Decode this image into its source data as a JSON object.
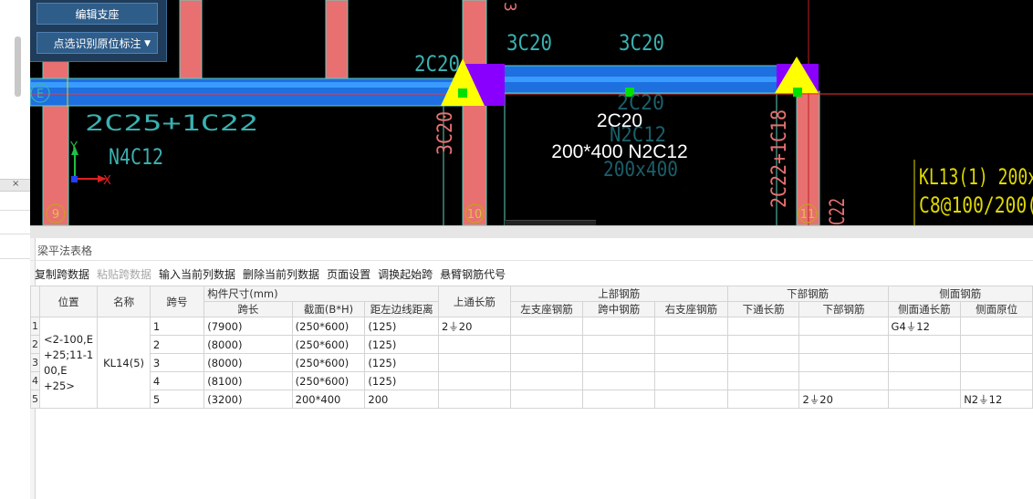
{
  "left_panel": {
    "close_glyph": "×"
  },
  "cad_menu": {
    "edit_support": "编辑支座",
    "pick_label": "点选识别原位标注"
  },
  "canvas": {
    "axes": {
      "grid_9": "9",
      "grid_10": "10",
      "grid_11": "11",
      "grid_E": "E",
      "axis_x": "X",
      "axis_y": "Y"
    },
    "labels": {
      "left_top": "2C25+1C22",
      "left_mid": "N4C12",
      "col_10_side": "3C20",
      "col_10_top": "2C20",
      "span_top_1": "3C20",
      "span_top_2": "3C20",
      "mid_faint_1": "2C20",
      "mid_faint_2": "N2C12",
      "mid_faint_3": "200x400",
      "popup_1": "2C20",
      "popup_2": "200*400 N2C12",
      "col_11_side": "2C22+1C18",
      "col_11_bottom": "C22",
      "top_right_digit": "3",
      "kl13_line1": "KL13(1) 200x",
      "kl13_line2": "C8@100/200("
    },
    "colors": {
      "beam": "#1e90ff",
      "column": "#e87070",
      "support": "#8a00ff",
      "marker": "#ffff00",
      "text_cyan": "#3ab0b0",
      "text_yellow": "#e0d800"
    }
  },
  "panel": {
    "title": "梁平法表格",
    "toolbar": [
      {
        "label": "复制跨数据",
        "enabled": true
      },
      {
        "label": "粘贴跨数据",
        "enabled": false
      },
      {
        "label": "输入当前列数据",
        "enabled": true
      },
      {
        "label": "删除当前列数据",
        "enabled": true
      },
      {
        "label": "页面设置",
        "enabled": true
      },
      {
        "label": "调换起始跨",
        "enabled": true
      },
      {
        "label": "悬臂钢筋代号",
        "enabled": true
      }
    ],
    "headers": {
      "position": "位置",
      "name": "名称",
      "span_no": "跨号",
      "member_size": "构件尺寸(mm)",
      "span_length": "跨长",
      "section": "截面(B*H)",
      "edge_distance": "距左边线距离",
      "top_through": "上通长筋",
      "top_rebar": "上部钢筋",
      "left_support": "左支座钢筋",
      "mid_span": "跨中钢筋",
      "right_support": "右支座钢筋",
      "bottom_rebar_group": "下部钢筋",
      "bottom_through": "下通长筋",
      "bottom_rebar": "下部钢筋",
      "side_rebar": "侧面钢筋",
      "side_through": "侧面通长筋",
      "side_in_situ": "侧面原位"
    },
    "position_value": "<2-100,E +25;11-1 00,E +25>",
    "name_value": "KL14(5)",
    "rows": [
      {
        "rn": "1",
        "span": "1",
        "length": "(7900)",
        "section": "(250*600)",
        "edge": "(125)",
        "top_through": "2⏚20",
        "bottom": "",
        "side_through": "G4⏚12",
        "side_in_situ": ""
      },
      {
        "rn": "2",
        "span": "2",
        "length": "(8000)",
        "section": "(250*600)",
        "edge": "(125)",
        "top_through": "",
        "bottom": "",
        "side_through": "",
        "side_in_situ": ""
      },
      {
        "rn": "3",
        "span": "3",
        "length": "(8000)",
        "section": "(250*600)",
        "edge": "(125)",
        "top_through": "",
        "bottom": "",
        "side_through": "",
        "side_in_situ": ""
      },
      {
        "rn": "4",
        "span": "4",
        "length": "(8100)",
        "section": "(250*600)",
        "edge": "(125)",
        "top_through": "",
        "bottom": "",
        "side_through": "",
        "side_in_situ": ""
      },
      {
        "rn": "5",
        "span": "5",
        "length": "(3200)",
        "section": "200*400",
        "edge": "200",
        "top_through": "",
        "bottom": "2⏚20",
        "side_through": "",
        "side_in_situ": "N2⏚12"
      }
    ]
  }
}
